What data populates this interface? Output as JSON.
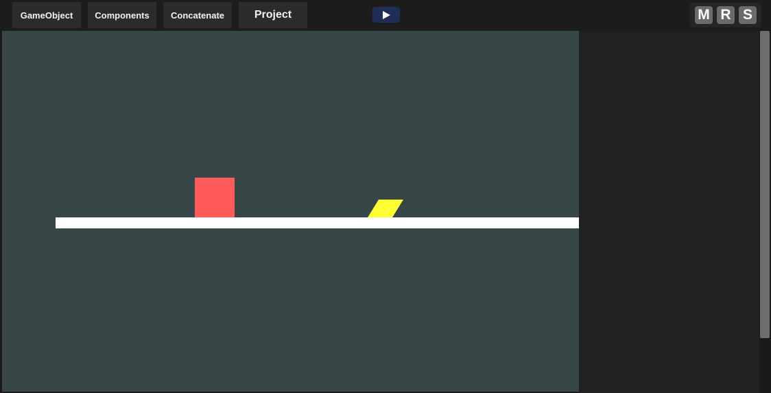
{
  "toolbar": {
    "menu": {
      "gameobject": "GameObject",
      "components": "Components",
      "concatenate": "Concatenate",
      "project": "Project"
    },
    "play_icon": "play-icon",
    "modes": {
      "m": "M",
      "r": "R",
      "s": "S"
    }
  },
  "scene": {
    "background_color": "#374646",
    "objects": {
      "ground_color": "#ffffff",
      "red_box_color": "#ff5b5b",
      "yellow_shape_color": "#ffff33"
    }
  },
  "colors": {
    "toolbar_bg": "#1c1c1c",
    "button_bg": "#2b2b2b",
    "play_button_bg": "#1f2d57",
    "mode_button_bg": "#6a6a6a",
    "panel_bg": "#212121"
  }
}
